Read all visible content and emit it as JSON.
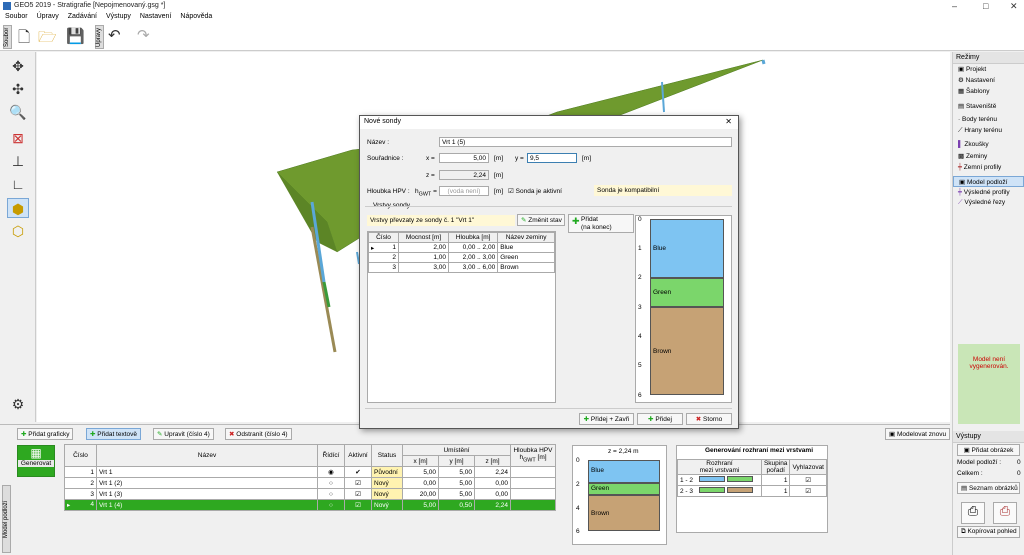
{
  "app": {
    "title": "GEO5 2019 - Stratigrafie [Nepojmenovaný.gsg *]",
    "window_controls": [
      "–",
      "□",
      "✕"
    ]
  },
  "menu": [
    "Soubor",
    "Úpravy",
    "Zadávání",
    "Výstupy",
    "Nastavení",
    "Nápověda"
  ],
  "toolbar": {
    "file_tab": "Soubor",
    "edit_tab": "Úpravy"
  },
  "right_panel": {
    "header": "Režimy",
    "items": [
      "Projekt",
      "Nastavení",
      "Šablony",
      "Staveniště",
      "Body terénu",
      "Hrany terénu",
      "Zkoušky",
      "Zeminy",
      "Zemní profily",
      "Model podloží",
      "Výsledné profily",
      "Výsledné řezy"
    ],
    "active": "Model podloží",
    "warning": "Model není vygenerován.",
    "outputs_header": "Výstupy",
    "add_image": "Přidat obrázek",
    "model_label": "Model podloží :",
    "model_value": "0",
    "total_label": "Celkem :",
    "total_value": "0",
    "list_images": "Seznam obrázků",
    "copy_view": "Kopírovat pohled"
  },
  "bottom": {
    "side_tab": "Model podloží",
    "buttons": {
      "add_graphic": "Přidat graficky",
      "add_text": "Přidat textově",
      "edit": "Upravit (číslo 4)",
      "remove": "Odstranit (číslo 4)",
      "model_again": "Modelovat znovu"
    },
    "generate": "Generovat",
    "headers": {
      "num": "Číslo",
      "name": "Název",
      "ridici": "Řídící",
      "active": "Aktivní",
      "status": "Status",
      "location": "Umístění",
      "x": "x [m]",
      "y": "y [m]",
      "z": "z [m]",
      "hpv": "Hloubka HPV",
      "hpv_unit": "h",
      "hpv_sub": "GWT",
      "hpv_m": "[m]"
    },
    "rows": [
      {
        "num": "1",
        "name": "Vrt 1",
        "ridici": "◉",
        "active": "✔",
        "status": "Původní",
        "x": "5,00",
        "y": "5,00",
        "z": "2,24"
      },
      {
        "num": "2",
        "name": "Vrt 1 (2)",
        "ridici": "○",
        "active": "☑",
        "status": "Nový",
        "x": "0,00",
        "y": "5,00",
        "z": "0,00"
      },
      {
        "num": "3",
        "name": "Vrt 1 (3)",
        "ridici": "○",
        "active": "☑",
        "status": "Nový",
        "x": "20,00",
        "y": "5,00",
        "z": "0,00"
      },
      {
        "num": "4",
        "name": "Vrt 1 (4)",
        "ridici": "○",
        "active": "☑",
        "status": "Nový",
        "x": "5,00",
        "y": "0,50",
        "z": "2,24"
      }
    ],
    "mini_profile": {
      "title": "z = 2,24 m",
      "ticks": [
        "0",
        "2",
        "4",
        "6"
      ],
      "layers": [
        "Blue",
        "Green",
        "Brown"
      ]
    },
    "interfaces": {
      "title": "Generování rozhraní mezi vrstvami",
      "h_rozhrani": "Rozhraní",
      "h_mezi": "mezi vrstvami",
      "h_skup": "Skupina",
      "h_poradi": "pořadí",
      "h_vyhl": "Vyhlazovat",
      "rows": [
        {
          "name": "1 - 2",
          "group": "1",
          "smooth": "☑"
        },
        {
          "name": "2 - 3",
          "group": "1",
          "smooth": "☑"
        }
      ]
    }
  },
  "dialog": {
    "title": "Nové sondy",
    "name_label": "Název :",
    "name_value": "Vrt 1 (5)",
    "coords_label": "Souřadnice :",
    "x_label": "x =",
    "x_value": "5,00",
    "x_unit": "[m]",
    "y_label": "y =",
    "y_value": "9,5",
    "y_unit": "[m]",
    "z_label": "z =",
    "z_value": "2,24",
    "z_unit": "[m]",
    "hpv_label": "Hloubka HPV :",
    "hgwt_label": "h",
    "hgwt_sub": "GWT",
    "hgwt_eq": "=",
    "hpv_placeholder": "(voda není)",
    "hpv_unit": "[m]",
    "active_label": "Sonda je aktivní",
    "compat": "Sonda je kompatibilní",
    "layers_group": "Vrstvy sondy",
    "layers_note": "Vrstvy převzaty ze sondy č. 1 \"Vrt 1\"",
    "change_state": "Změnit stav",
    "add_label": "Přidat",
    "add_sub": "(na konec)",
    "table_headers": {
      "num": "Číslo",
      "thickness": "Mocnost [m]",
      "depth": "Hloubka [m]",
      "soil": "Název zeminy"
    },
    "layers": [
      {
        "num": "1",
        "thickness": "2,00",
        "depth": "0,00 .. 2,00",
        "soil": "Blue"
      },
      {
        "num": "2",
        "thickness": "1,00",
        "depth": "2,00 .. 3,00",
        "soil": "Green"
      },
      {
        "num": "3",
        "thickness": "3,00",
        "depth": "3,00 .. 6,00",
        "soil": "Brown"
      }
    ],
    "profile_ticks": [
      "0",
      "1",
      "2",
      "3",
      "4",
      "5",
      "6"
    ],
    "buttons": {
      "add_close": "Přidej + Zavři",
      "add": "Přidej",
      "cancel": "Storno"
    }
  },
  "colors": {
    "blue": "#7ec4f2",
    "green": "#7bd66b",
    "brown": "#c6a275",
    "selected": "#2ea820",
    "terrain": "#6f9a2e"
  }
}
